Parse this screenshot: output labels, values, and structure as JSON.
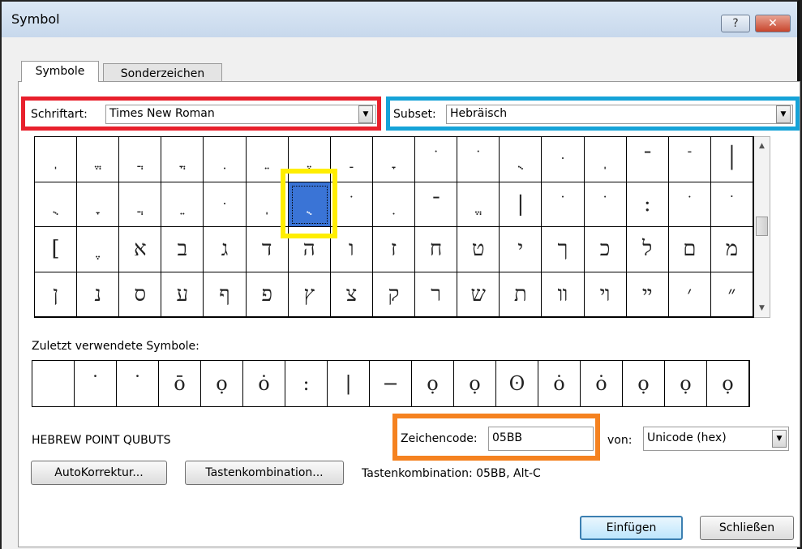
{
  "window": {
    "title": "Symbol",
    "help": "?",
    "close": "✕"
  },
  "tabs": [
    {
      "label": "Symbole",
      "underline": "b"
    },
    {
      "label": "Sonderzeichen",
      "underline": "S"
    }
  ],
  "font": {
    "label": "Schriftart:",
    "value": "Times New Roman"
  },
  "subset": {
    "label": "Subset:",
    "value": "Hebräisch"
  },
  "symbols": [
    "ֽ",
    "ֱ",
    "ֲ",
    "ֳ",
    "ִ",
    "ֵ",
    "ֶ",
    "ַ",
    "ָ",
    "ֹ",
    "ֺ",
    "ֻ",
    "ּ",
    "ֽ",
    "־",
    "ֿ",
    "׀",
    "ֻ",
    "ָ",
    "ֲ",
    "ֵ",
    "ּ",
    "ֽ",
    "ֻ",
    "ֹ",
    "ִ",
    "־",
    "ֱ",
    "|",
    "ֹ",
    "ֺ",
    ":",
    "ׂ",
    "ׁ",
    "[",
    "ֶ",
    "א",
    "ב",
    "ג",
    "ד",
    "ה",
    "ו",
    "ז",
    "ח",
    "ט",
    "י",
    "ך",
    "כ",
    "ל",
    "ם",
    "מ",
    "ן",
    "נ",
    "ס",
    "ע",
    "ף",
    "פ",
    "ץ",
    "צ",
    "ק",
    "ר",
    "ש",
    "ת",
    "װ",
    "ױ",
    "ײ",
    "׳",
    "״"
  ],
  "selected_index": 23,
  "recent": {
    "label": "Zuletzt verwendete Symbole:",
    "items": [
      " ",
      "˙",
      "˙",
      "ō",
      "ọ",
      "ȯ",
      ":",
      "|",
      "−",
      "ọ",
      "ọ",
      "ʘ",
      "ȯ",
      "ȯ",
      "ọ",
      "ọ",
      "ọ"
    ]
  },
  "char_name": "HEBREW POINT QUBUTS",
  "code": {
    "label": "Zeichencode:",
    "value": "05BB",
    "from_label": "von:",
    "from_value": "Unicode (hex)"
  },
  "buttons": {
    "autocorrect": "AutoKorrektur...",
    "shortcut": "Tastenkombination...",
    "shortcut_info": "Tastenkombination: 05BB, Alt-C",
    "insert": "Einfügen",
    "close": "Schließen"
  },
  "colors": {
    "red": "#e8202c",
    "blue": "#16a3d8",
    "yellow": "#ffee00",
    "orange": "#f58220",
    "selection": "#3a74d6"
  }
}
